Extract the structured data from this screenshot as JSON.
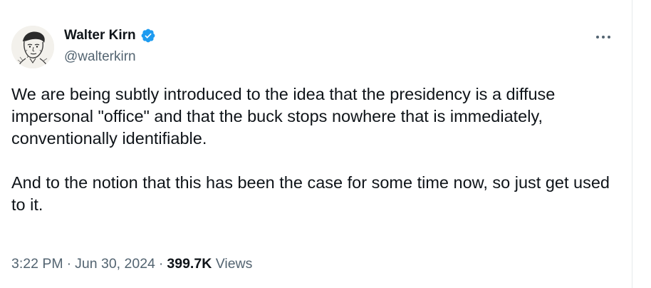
{
  "author": {
    "display_name": "Walter Kirn",
    "handle": "@walterkirn",
    "avatar_icon": "portrait-sketch",
    "verified_icon": "verified-badge-icon",
    "verified_color": "#1d9bf0"
  },
  "tweet": {
    "paragraphs": [
      "We are being subtly introduced to the idea that the presidency is a diffuse impersonal \"office\" and that the buck stops nowhere that is immediately, conventionally identifiable.",
      "And to the notion that this has been the case for some time now, so just get used to it."
    ]
  },
  "meta": {
    "time": "3:22 PM",
    "separator": "·",
    "date": "Jun 30, 2024",
    "views_count": "399.7K",
    "views_label": "Views"
  },
  "actions": {
    "more_icon": "more-dots-icon"
  },
  "colors": {
    "text_primary": "#0f1419",
    "text_secondary": "#536471",
    "accent": "#1d9bf0"
  }
}
